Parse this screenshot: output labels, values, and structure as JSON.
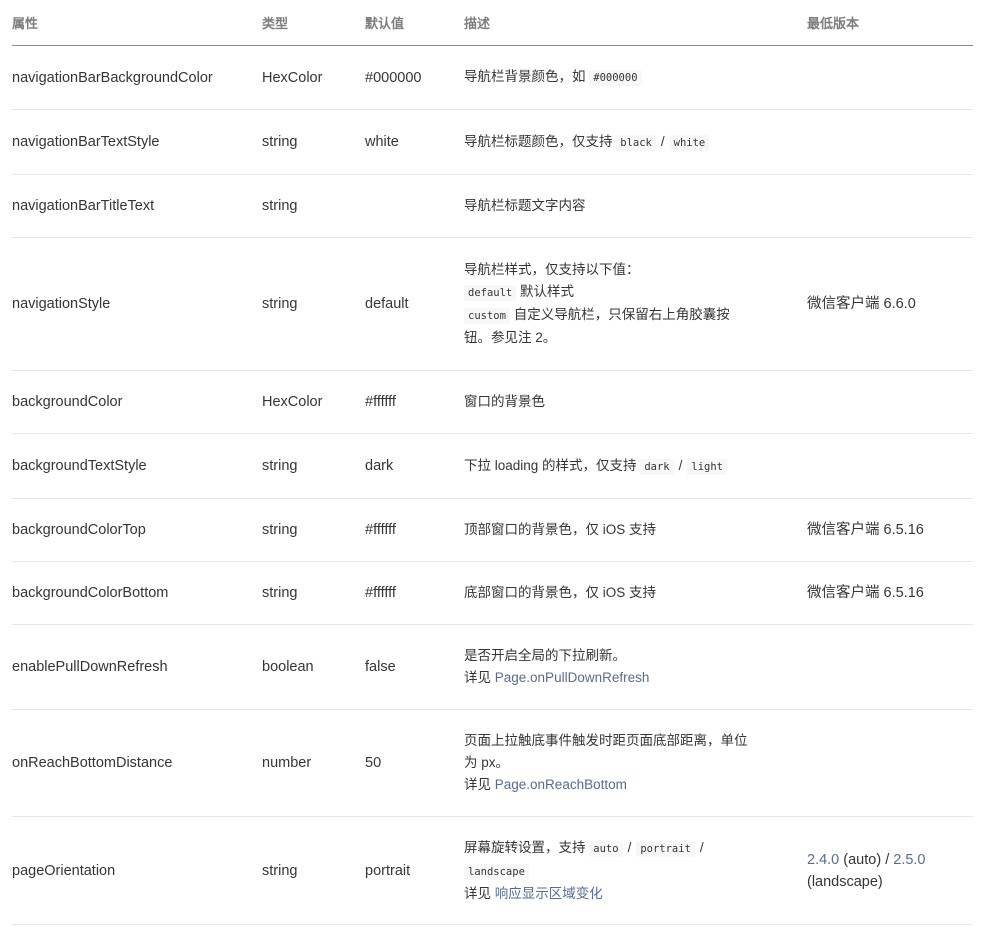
{
  "headers": {
    "attr": "属性",
    "type": "类型",
    "default": "默认值",
    "desc": "描述",
    "version": "最低版本"
  },
  "rows": [
    {
      "attr": "navigationBarBackgroundColor",
      "type": "HexColor",
      "default": "#000000",
      "desc_text": "导航栏背景颜色，如",
      "desc_code": "#000000",
      "version": ""
    },
    {
      "attr": "navigationBarTextStyle",
      "type": "string",
      "default": "white",
      "desc_text": "导航栏标题颜色，仅支持",
      "code1": "black",
      "slash": "/",
      "code2": "white",
      "version": ""
    },
    {
      "attr": "navigationBarTitleText",
      "type": "string",
      "default": "",
      "desc": "导航栏标题文字内容",
      "version": ""
    },
    {
      "attr": "navigationStyle",
      "type": "string",
      "default": "default",
      "desc_line1": "导航栏样式，仅支持以下值：",
      "opt1_code": "default",
      "opt1_text": "默认样式",
      "opt2_code": "custom",
      "opt2_text": "自定义导航栏，只保留右上角胶囊按",
      "opt2_text_cont": "钮。参见注 2。",
      "version": "微信客户端 6.6.0"
    },
    {
      "attr": "backgroundColor",
      "type": "HexColor",
      "default": "#ffffff",
      "desc": "窗口的背景色",
      "version": ""
    },
    {
      "attr": "backgroundTextStyle",
      "type": "string",
      "default": "dark",
      "desc_text": "下拉 loading 的样式，仅支持",
      "code1": "dark",
      "slash": "/",
      "code2": "light",
      "version": ""
    },
    {
      "attr": "backgroundColorTop",
      "type": "string",
      "default": "#ffffff",
      "desc": "顶部窗口的背景色，仅 iOS 支持",
      "version": "微信客户端 6.5.16"
    },
    {
      "attr": "backgroundColorBottom",
      "type": "string",
      "default": "#ffffff",
      "desc": "底部窗口的背景色，仅 iOS 支持",
      "version": "微信客户端 6.5.16"
    },
    {
      "attr": "enablePullDownRefresh",
      "type": "boolean",
      "default": "false",
      "desc_line1": "是否开启全局的下拉刷新。",
      "see": "详见",
      "link": "Page.onPullDownRefresh",
      "version": ""
    },
    {
      "attr": "onReachBottomDistance",
      "type": "number",
      "default": "50",
      "desc_line1": "页面上拉触底事件触发时距页面底部距离，单位",
      "desc_line2": "为 px。",
      "see": "详见",
      "link": "Page.onReachBottom",
      "version": ""
    },
    {
      "attr": "pageOrientation",
      "type": "string",
      "default": "portrait",
      "desc_text": "屏幕旋转设置，支持",
      "code1": "auto",
      "slash": "/",
      "code2": "portrait",
      "code3": "landscape",
      "see": "详见",
      "link": "响应显示区域变化",
      "version_link1": "2.4.0",
      "version_mid": "(auto) /",
      "version_link2": "2.5.0",
      "version_tail": "(landscape)"
    }
  ]
}
